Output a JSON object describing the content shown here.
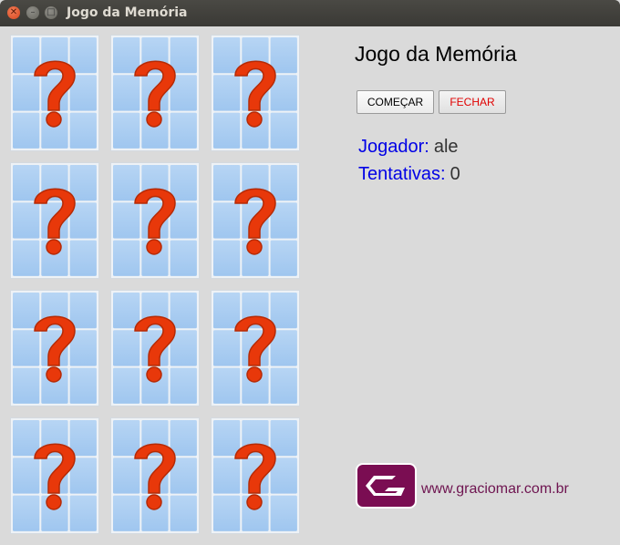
{
  "window": {
    "title": "Jogo da Memória"
  },
  "game": {
    "heading": "Jogo da Memória",
    "buttons": {
      "start": "COMEÇAR",
      "close": "FECHAR"
    },
    "player": {
      "label": "Jogador:",
      "value": "ale"
    },
    "attempts": {
      "label": "Tentativas:",
      "value": "0"
    }
  },
  "board": {
    "rows": 4,
    "columns": 3,
    "card_face": "question-mark-icon",
    "colors": {
      "tile": "#9fc6ef",
      "question_mark": "#e8380a",
      "card_back": "#eef2f6"
    }
  },
  "footer": {
    "logo_icon": "graciomar-logo-icon",
    "logo_color": "#7a0d52",
    "website": "www.graciomar.com.br"
  }
}
